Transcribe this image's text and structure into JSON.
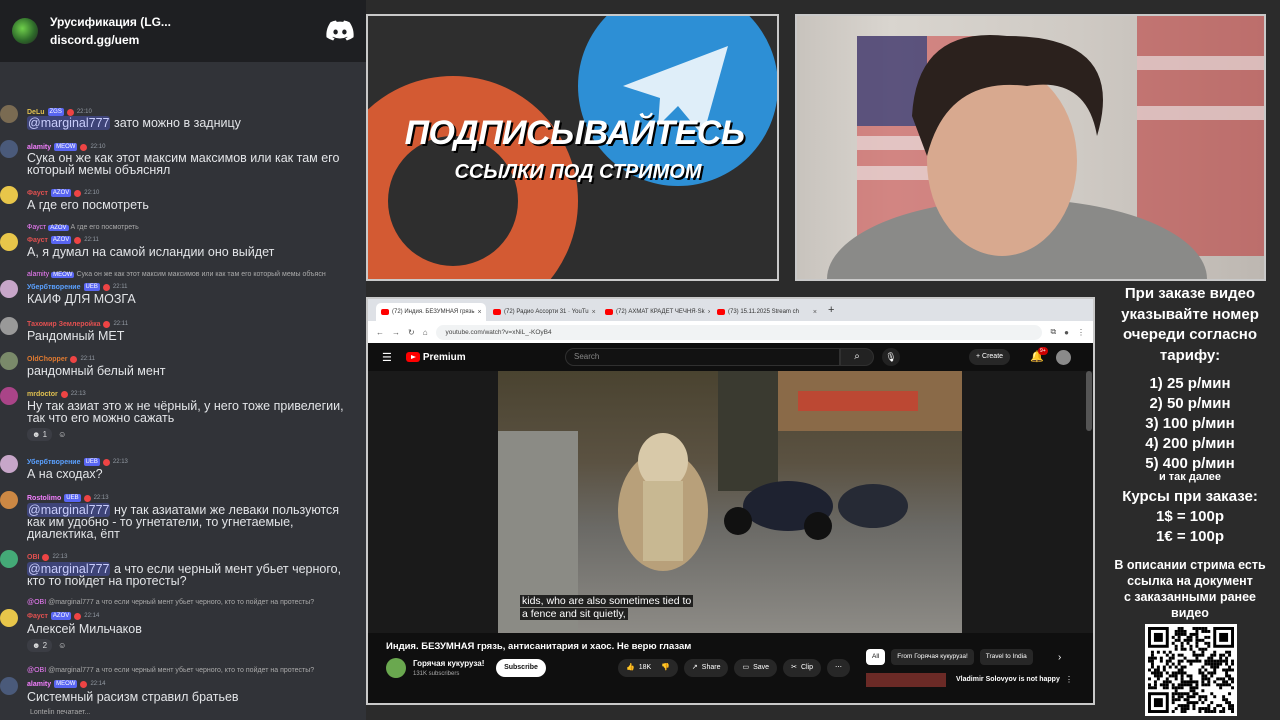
{
  "server": {
    "name": "Урусификация (LG...",
    "invite": "discord.gg/uem",
    "icon": "discord-icon"
  },
  "chat": {
    "messages": [
      {
        "user": "DeLu",
        "badge": "ZGS",
        "time": "22:10",
        "color": "#e0c050",
        "mention": "@marginal777",
        "text": "зато можно в задницу"
      },
      {
        "user": "alamity",
        "badge": "MEOW",
        "time": "22:10",
        "color": "#f47fff",
        "text_lines": [
          "Сука он же как этот максим максимов или как там его",
          "который мемы объяснял"
        ]
      },
      {
        "user": "Фауст",
        "badge": "AZOV",
        "time": "22:10",
        "color": "#e05050",
        "text": "А где его посмотреть"
      },
      {
        "user": "Фауст",
        "badge": "AZOV",
        "time": "22:11",
        "color": "#e05050",
        "reply_user": "Фауст",
        "reply_badge": "AZOV",
        "reply": "А где его посмотреть",
        "text": "А, я думал на самой исландии оно выйдет"
      },
      {
        "user": "Убербтворение",
        "badge": "UEB",
        "time": "22:11",
        "color": "#5aa0ff",
        "reply_user": "alamity",
        "reply_badge": "MEOW",
        "reply": "Сука он же как этот максим максимов или как там его который мемы объясн",
        "text": "КАИФ ДЛЯ МОЗГА"
      },
      {
        "user": "Тахомир Землеройка",
        "time": "22:11",
        "color": "#e05050",
        "text": "Рандомный МЕТ"
      },
      {
        "user": "OldChopper",
        "time": "22:11",
        "color": "#e07a30",
        "text": "рандомный белый мент"
      },
      {
        "user": "mrdoctor",
        "time": "22:13",
        "color": "#e0c050",
        "text_lines": [
          "Ну так азиат это ж не чёрный, у него тоже привелегии,",
          "так что его можно сажать"
        ],
        "reaction_count": "1"
      },
      {
        "user": "Убербтворение",
        "badge": "UEB",
        "time": "22:13",
        "color": "#5aa0ff",
        "text": "А на сходах?"
      },
      {
        "user": "Rostolimo",
        "badge": "UEB",
        "time": "22:13",
        "color": "#f47fff",
        "mention": "@marginal777",
        "text_lines": [
          "ну так азиатами же леваки пользуются",
          "как им удобно - то угнетатели, то угнетаемые,",
          "диалектика, ёпт"
        ]
      },
      {
        "user": "OBI",
        "time": "22:13",
        "color": "#e05050",
        "mention": "@marginal777",
        "text_lines": [
          "а что если черный мент убьет черного,",
          "кто то пойдет на протесты?"
        ]
      },
      {
        "user": "Фауст",
        "badge": "AZOV",
        "time": "22:14",
        "color": "#e05050",
        "reply_user": "@OBI",
        "reply": "@marginal777 а что если черный мент убьет черного, кто то пойдет на протесты?",
        "text": "Алексей Мильчаков",
        "reaction_count": "2"
      },
      {
        "user": "alamity",
        "badge": "MEOW",
        "time": "22:14",
        "color": "#f47fff",
        "reply_user": "@OBI",
        "reply": "@marginal777 а что если черный мент убьет черного, кто то пойдет на протесты?",
        "text": "Системный расизм стравил братьев"
      }
    ],
    "typing": "Lontelin печатает..."
  },
  "promo": {
    "title": "ПОДПИСЫВАЙТЕСЬ",
    "subtitle": "ССЫЛКИ ПОД СТРИМОМ"
  },
  "browser": {
    "tabs": [
      {
        "label": "(72) Индия. БЕЗУМНАЯ грязь",
        "active": true
      },
      {
        "label": "(72) Радио Ассорти 31 · YouTu",
        "active": false
      },
      {
        "label": "(72) АХМАТ КРАДЕТ ЧЕЧНЯ·Sk",
        "active": false
      },
      {
        "label": "(73) 15.11.2025 Stream ch",
        "active": false
      }
    ],
    "url": "youtube.com/watch?v=xNiL_-KOyB4"
  },
  "youtube": {
    "logo_text": "Premium",
    "search_placeholder": "Search",
    "create_label": "+ Create",
    "notifications": "9+",
    "caption_lines": [
      "kids, who are also sometimes tied to",
      "a fence and sit quietly,"
    ],
    "video_title": "Индия. БЕЗУМНАЯ грязь, антисанитария и хаос. Не верю глазам",
    "channel_name": "Горячая кукуруза!",
    "subscribers": "131K subscribers",
    "subscribe_label": "Subscribe",
    "likes": "18K",
    "share_label": "Share",
    "save_label": "Save",
    "clip_label": "Clip",
    "chips": [
      "All",
      "From Горячая кукуруза!",
      "Travel to India"
    ],
    "rec_title": "Vladimir Solovyov is not happy"
  },
  "pricing": {
    "head_lines": [
      "При заказе видео",
      "указывайте номер",
      "очереди согласно",
      "тарифу:"
    ],
    "tiers": [
      "1) 25 р/мин",
      "2) 50 р/мин",
      "3) 100 р/мин",
      "4) 200 р/мин",
      "5) 400 р/мин"
    ],
    "and_more": "и так далее",
    "rates_title": "Курсы при заказе:",
    "rates": [
      "1$ = 100р",
      "1€ = 100р"
    ],
    "note_lines": [
      "В описании стрима есть",
      "ссылка на документ",
      "с заказанными ранее",
      "видео"
    ]
  }
}
